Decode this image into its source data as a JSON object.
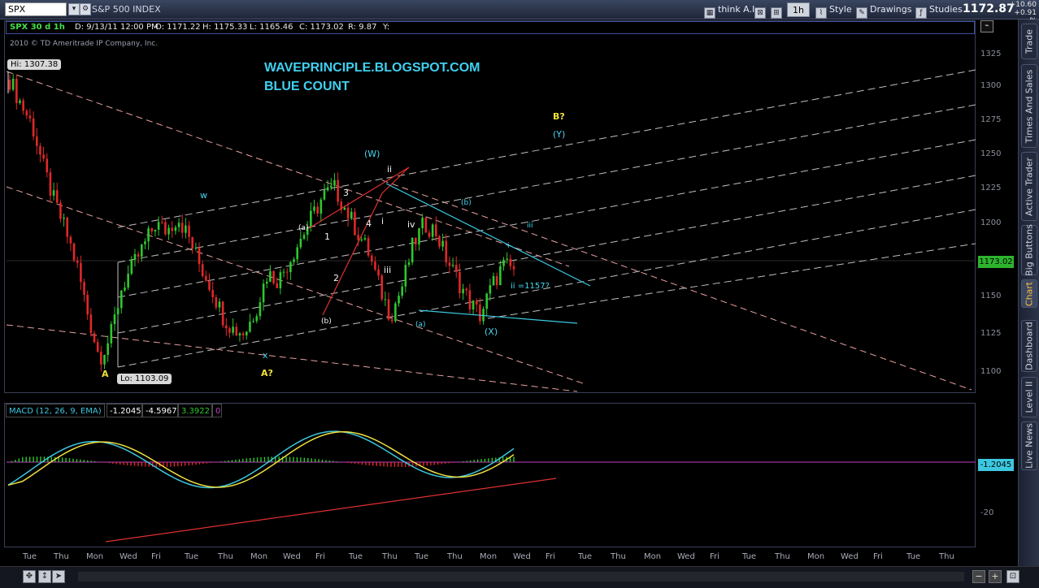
{
  "toolbar": {
    "symbol": "SPX",
    "description": "S&P 500 INDEX",
    "think_label": "think A.I.",
    "timeframe": "1h",
    "style_label": "Style",
    "drawings_label": "Drawings",
    "studies_label": "Studies",
    "last_price": "1172.87",
    "change_abs": "+10.60",
    "change_pct": "+0.91 %"
  },
  "sidebar": {
    "tabs": [
      {
        "label": "Trade",
        "active": false
      },
      {
        "label": "Times And Sales",
        "active": false
      },
      {
        "label": "Active Trader",
        "active": false
      },
      {
        "label": "Big Buttons",
        "active": false
      },
      {
        "label": "Chart",
        "active": true
      },
      {
        "label": "Dashboard",
        "active": false
      },
      {
        "label": "Level II",
        "active": false
      },
      {
        "label": "Live News",
        "active": false
      }
    ]
  },
  "chart_header": {
    "title": "SPX 30 d 1h",
    "date": "D: 9/13/11 12:00 PM",
    "open": "O: 1171.22",
    "high": "H: 1175.33",
    "low": "L: 1165.46",
    "close": "C: 1173.02",
    "range": "R: 9.87",
    "y": "Y:"
  },
  "copyright": "2010 © TD Ameritrade IP Company, Inc.",
  "annotations": {
    "title1": "WAVEPRINCIPLE.BLOGSPOT.COM",
    "title2": "BLUE COUNT",
    "hi_label": "Hi: 1307.38",
    "lo_label": "Lo: 1103.09",
    "A": "A",
    "A_q": "A?",
    "B_q": "B?",
    "Y": "(Y)",
    "W": "(W)",
    "w": "w",
    "x": "x",
    "ii_top": "ii",
    "three": "3",
    "four": "4",
    "one": "1",
    "two": "2",
    "a_small": "(a)",
    "b_small": "(b)",
    "i": "i",
    "iii": "iii",
    "iv": "iv",
    "b_blue": "(b)",
    "a_blue": "(a)",
    "iii_blue": "iii",
    "i_blue": "i",
    "ii_note": "ii =1157?",
    "X": "(X)"
  },
  "price_axis": {
    "ticks": [
      "1325",
      "1300",
      "1275",
      "1250",
      "1225",
      "1200",
      "1175",
      "1150",
      "1125",
      "1100"
    ],
    "current_price": "1173.02"
  },
  "macd": {
    "label": "MACD (12, 26, 9, EMA)",
    "value": "-1.2045",
    "avg": "-4.5967",
    "diff": "3.3922",
    "zero": "0",
    "axis_tick": "-20",
    "badge": "-1.2045"
  },
  "x_axis": {
    "labels": [
      "Tue",
      "Thu",
      "Mon",
      "Wed",
      "Fri",
      "Tue",
      "Thu",
      "Mon",
      "Wed",
      "Fri",
      "Tue",
      "Thu",
      "Tue",
      "Thu",
      "Mon",
      "Wed",
      "Fri",
      "Tue",
      "Thu",
      "Mon",
      "Wed",
      "Fri",
      "Tue",
      "Thu",
      "Mon",
      "Wed",
      "Fri",
      "Tue",
      "Thu"
    ]
  },
  "chart_data": {
    "type": "candlestick",
    "interval": "1h",
    "ylim": [
      1095,
      1330
    ],
    "approx_price_path": [
      1307,
      1290,
      1275,
      1245,
      1220,
      1200,
      1175,
      1140,
      1110,
      1125,
      1160,
      1175,
      1190,
      1205,
      1200,
      1210,
      1195,
      1175,
      1160,
      1140,
      1130,
      1128,
      1145,
      1170,
      1165,
      1180,
      1195,
      1210,
      1225,
      1230,
      1215,
      1200,
      1185,
      1160,
      1140,
      1160,
      1190,
      1205,
      1200,
      1180,
      1165,
      1150,
      1140,
      1160,
      1175,
      1173
    ],
    "colors": {
      "up": "#2ec82e",
      "down": "#e02828"
    }
  }
}
